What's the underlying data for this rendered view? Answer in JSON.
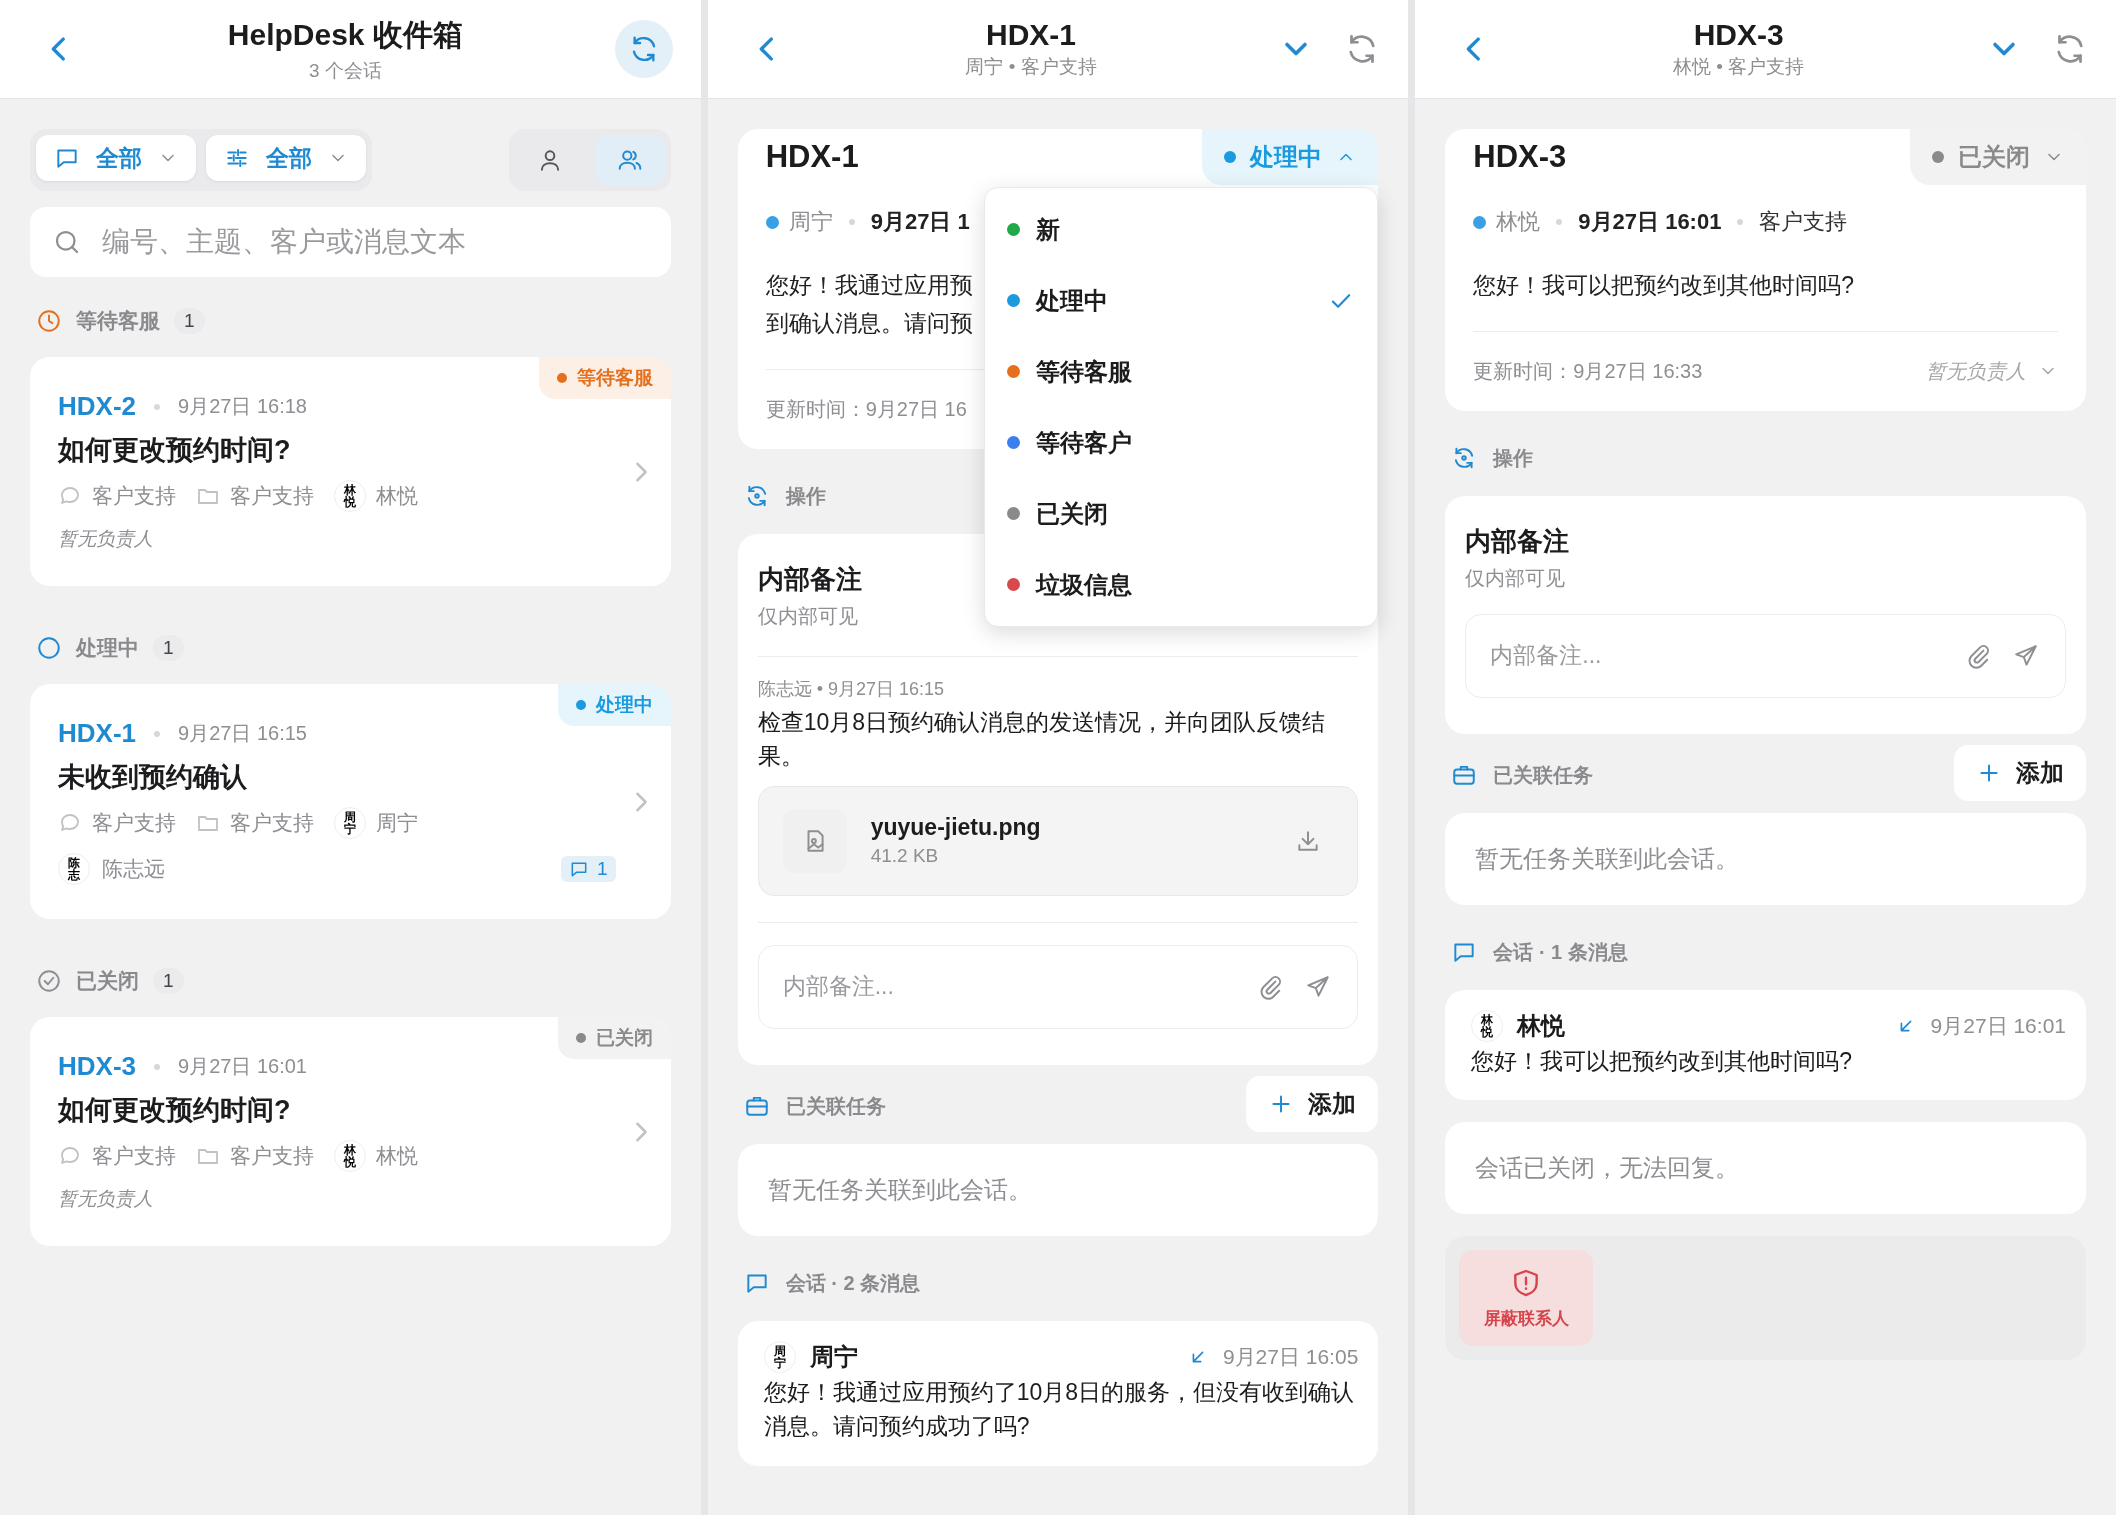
{
  "inbox": {
    "title": "HelpDesk 收件箱",
    "subtitle": "3 个会话",
    "filters": [
      {
        "kind": "channel",
        "label": "全部"
      },
      {
        "kind": "attribute",
        "label": "全部"
      }
    ],
    "scope": [
      {
        "kind": "mine",
        "selected": false
      },
      {
        "kind": "team",
        "selected": true
      }
    ],
    "search": {
      "placeholder": "编号、主题、客户或消息文本"
    },
    "groups": [
      {
        "kind": "waiting",
        "title": "等待客服",
        "count": "1",
        "tickets": [
          {
            "id": "HDX-2",
            "time": "9月27日 16:18",
            "status": {
              "label": "等待客服",
              "color": "#e4701e"
            },
            "subject": "如何更改预约时间?",
            "channel": "客户支持",
            "inbox": "客户支持",
            "customer": {
              "name": "林悦",
              "avatar": "林悦"
            },
            "assignee": {
              "kind": "none",
              "name": "暂无负责人"
            }
          }
        ]
      },
      {
        "kind": "processing",
        "title": "处理中",
        "count": "1",
        "tickets": [
          {
            "id": "HDX-1",
            "time": "9月27日 16:15",
            "status": {
              "label": "处理中",
              "color": "#1a9be0"
            },
            "subject": "未收到预约确认",
            "channel": "客户支持",
            "inbox": "客户支持",
            "customer": {
              "name": "周宁",
              "avatar": "周宁"
            },
            "assignee": {
              "kind": "agent",
              "name": "陈志远",
              "avatar": "陈志"
            },
            "comments": "1"
          }
        ]
      },
      {
        "kind": "closed",
        "title": "已关闭",
        "count": "1",
        "tickets": [
          {
            "id": "HDX-3",
            "time": "9月27日 16:01",
            "status": {
              "label": "已关闭",
              "color": "#8a8a8a"
            },
            "subject": "如何更改预约时间?",
            "channel": "客户支持",
            "inbox": "客户支持",
            "customer": {
              "name": "林悦",
              "avatar": "林悦"
            },
            "assignee": {
              "kind": "none",
              "name": "暂无负责人"
            }
          }
        ]
      }
    ]
  },
  "details": [
    {
      "title": "HDX-1",
      "subtitle": "周宁 • 客户支持",
      "summary": {
        "id": "HDX-1",
        "status": {
          "label": "处理中",
          "color": "#1a9be0",
          "expanded": true
        },
        "presence": {
          "color": "#3aa0e6"
        },
        "customer": "周宁",
        "time": "9月27日 1",
        "message_lines": [
          "您好！我通过应用预",
          "到确认消息。请问预"
        ],
        "updated": "更新时间：9月27日 16"
      },
      "status_menu": [
        {
          "label": "新",
          "color": "#22a84a",
          "selected": false
        },
        {
          "label": "处理中",
          "color": "#1a9be0",
          "selected": true
        },
        {
          "label": "等待客服",
          "color": "#e4701e",
          "selected": false
        },
        {
          "label": "等待客户",
          "color": "#3a7ef0",
          "selected": false
        },
        {
          "label": "已关闭",
          "color": "#8a8a8a",
          "selected": false
        },
        {
          "label": "垃圾信息",
          "color": "#d9484a",
          "selected": false
        }
      ],
      "actions_label": "操作",
      "notes": {
        "title": "内部备注",
        "subtitle": "仅内部可见",
        "items": [
          {
            "meta": "陈志远 • 9月27日 16:15",
            "text": "检查10月8日预约确认消息的发送情况，并向团队反馈结果。",
            "attachments": [
              {
                "name": "yuyue-jietu.png",
                "size": "41.2 KB"
              }
            ]
          }
        ],
        "input": {
          "placeholder": "内部备注..."
        }
      },
      "tasks": {
        "label": "已关联任务",
        "add": "添加",
        "empty": "暂无任务关联到此会话。"
      },
      "conversation": {
        "label": "会话 · 2 条消息",
        "messages": [
          {
            "sender": "周宁",
            "avatar": "周宁",
            "kind": "inbound",
            "time": "9月27日 16:05",
            "text": "您好！我通过应用预约了10月8日的服务，但没有收到确认消息。请问预约成功了吗?"
          }
        ]
      }
    },
    {
      "title": "HDX-3",
      "subtitle": "林悦 • 客户支持",
      "summary": {
        "id": "HDX-3",
        "status": {
          "label": "已关闭",
          "color": "#8a8a8a",
          "expanded": false
        },
        "presence": {
          "color": "#3aa0e6"
        },
        "customer": "林悦",
        "time": "9月27日 16:01",
        "channel": "客户支持",
        "message_lines": [
          "您好！我可以把预约改到其他时间吗?"
        ],
        "updated": "更新时间：9月27日 16:33",
        "assignee": "暂无负责人"
      },
      "actions_label": "操作",
      "notes": {
        "title": "内部备注",
        "subtitle": "仅内部可见",
        "input": {
          "placeholder": "内部备注..."
        }
      },
      "tasks": {
        "label": "已关联任务",
        "add": "添加",
        "empty": "暂无任务关联到此会话。"
      },
      "conversation": {
        "label": "会话 · 1 条消息",
        "messages": [
          {
            "sender": "林悦",
            "avatar": "林悦",
            "kind": "inbound",
            "time": "9月27日 16:01",
            "text": "您好！我可以把预约改到其他时间吗?"
          }
        ],
        "closed_notice": "会话已关闭，无法回复。",
        "actions": [
          {
            "kind": "block",
            "label": "屏蔽联系人"
          }
        ]
      }
    }
  ]
}
